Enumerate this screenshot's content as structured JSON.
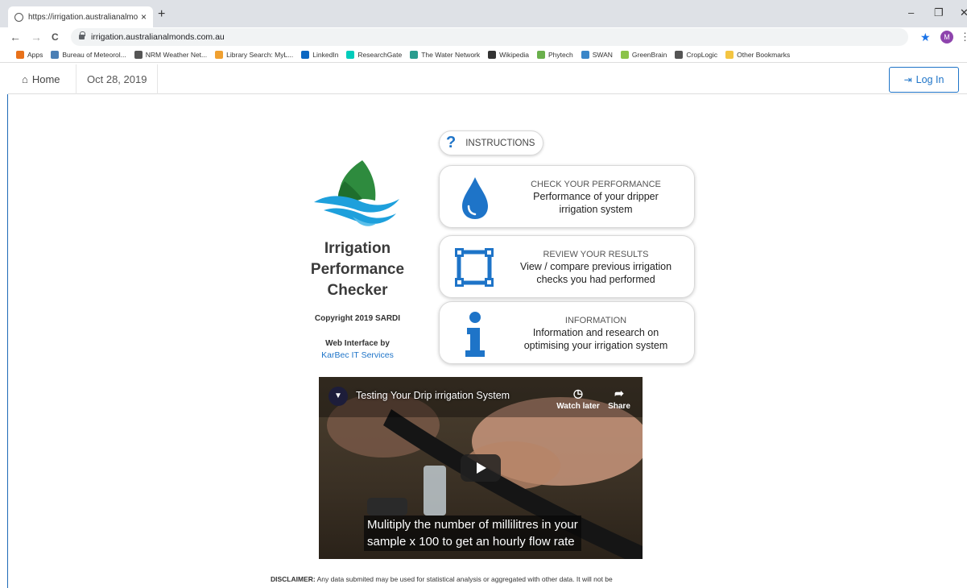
{
  "browser": {
    "tab_title": "https://irrigation.australianalmon",
    "tab_close": "×",
    "new_tab": "+",
    "back": "←",
    "forward": "→",
    "reload": "C",
    "url": "irrigation.australianalmonds.com.au",
    "profile_initial": "M",
    "bookmarks": [
      {
        "label": "Apps",
        "icon": "apps-icon",
        "color": "#e8711a"
      },
      {
        "label": "Bureau of Meteorol...",
        "icon": "bom-icon",
        "color": "#4a7fb5"
      },
      {
        "label": "NRM Weather Net...",
        "icon": "nrm-icon",
        "color": "#555555"
      },
      {
        "label": "Library Search: MyL...",
        "icon": "library-icon",
        "color": "#f0a030"
      },
      {
        "label": "LinkedIn",
        "icon": "linkedin-icon",
        "color": "#0a66c2"
      },
      {
        "label": "ResearchGate",
        "icon": "researchgate-icon",
        "color": "#00ccbb"
      },
      {
        "label": "The Water Network",
        "icon": "water-network-icon",
        "color": "#2a9d8f"
      },
      {
        "label": "Wikipedia",
        "icon": "wikipedia-icon",
        "color": "#333333"
      },
      {
        "label": "Phytech",
        "icon": "phytech-icon",
        "color": "#6ab04c"
      },
      {
        "label": "SWAN",
        "icon": "swan-icon",
        "color": "#3a86c8"
      },
      {
        "label": "GreenBrain",
        "icon": "greenbrain-icon",
        "color": "#8bc34a"
      },
      {
        "label": "CropLogic",
        "icon": "croplogic-icon",
        "color": "#555555"
      },
      {
        "label": "Other Bookmarks",
        "icon": "folder-icon",
        "color": "#f4c542"
      }
    ]
  },
  "nav": {
    "home": "Home",
    "date": "Oct 28, 2019",
    "login": "Log In"
  },
  "app": {
    "title_line1": "Irrigation",
    "title_line2": "Performance",
    "title_line3": "Checker",
    "copyright": "Copyright 2019 SARDI",
    "web_interface_by": "Web Interface by",
    "developer": "KarBec IT Services"
  },
  "actions": {
    "instructions": "INSTRUCTIONS",
    "check": {
      "heading": "CHECK YOUR PERFORMANCE",
      "line1": "Performance of your dripper",
      "line2": "irrigation system"
    },
    "review": {
      "heading": "REVIEW YOUR RESULTS",
      "line1": "View / compare previous irrigation",
      "line2": "checks you had performed"
    },
    "info": {
      "heading": "INFORMATION",
      "line1": "Information and research on",
      "line2": "optimising your irrigation system"
    }
  },
  "video": {
    "title": "Testing Your Drip irrigation System",
    "watch_later": "Watch later",
    "share": "Share",
    "caption_line1": "Mulitiply the number of millilitres in your",
    "caption_line2": "sample x 100 to get an  hourly flow rate"
  },
  "footer": {
    "disclaimer_label": "DISCLAIMER:",
    "disclaimer_text": " Any data submited may be used for statistical analysis or aggregated with other data. It will not be"
  },
  "colors": {
    "accent": "#1e74c8",
    "logo_green": "#2e8b3e",
    "logo_blue": "#1ea0dc"
  }
}
